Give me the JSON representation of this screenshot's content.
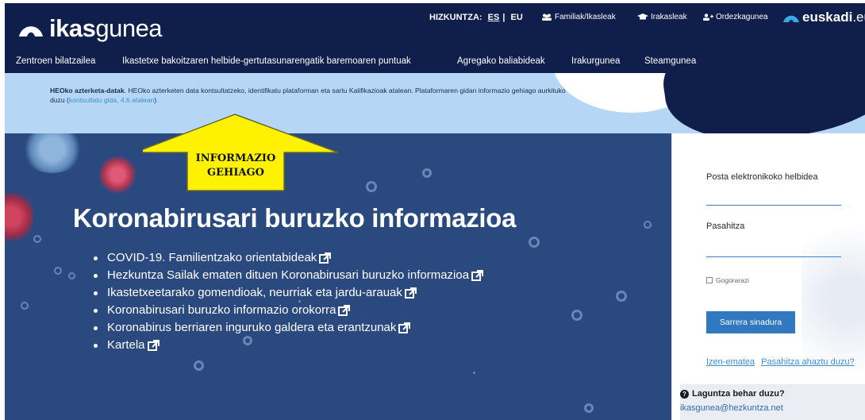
{
  "header": {
    "logo_bold": "ikas",
    "logo_light": "gunea",
    "language_label": "HIZKUNTZA:",
    "lang_es": "ES",
    "lang_sep": "|",
    "lang_eu": "EU",
    "link_families": "Familiak/Ikasleak",
    "link_teachers": "Irakasleak",
    "link_representatives": "Ordezkagunea",
    "euskadi_bold": "euskadi",
    "euskadi_light": ".eus"
  },
  "nav": {
    "items": [
      "Zentroen bilatzailea",
      "Ikastetxe bakoitzaren helbide-gertutasunarengatik baremoaren puntuak",
      "Agregako baliabideak",
      "Irakurgunea",
      "Steamgunea"
    ]
  },
  "notice": {
    "bold": "HEOko azterketa-datak",
    "text": ". HEOko azterketen data kontsultatzeko, identifikatu plataforman eta sartu Kalifikazioak atalean. Plataformaren gidan informazio gehiago aurkituko duzu (",
    "link": "kontsultatu gida, 4.6 atalean",
    "close": ")"
  },
  "annotation": {
    "line1": "INFORMAZIO",
    "line2": "GEHIAGO"
  },
  "hero": {
    "title": "Koronabirusari buruzko informazioa",
    "items": [
      "COVID-19. Familientzako orientabideak",
      "Hezkuntza Sailak ematen dituen Koronabirusari buruzko informazioa",
      "Ikastetxeetarako gomendioak, neurriak eta jardu-arauak",
      "Koronabirusari buruzko informazio orokorra",
      "Koronabirus berriaren inguruko galdera eta erantzunak",
      "Kartela"
    ]
  },
  "login": {
    "email_label": "Posta elektronikoko helbidea",
    "password_label": "Pasahitza",
    "remember_label": "Gogorarazi",
    "signin_button": "Sarrera sinadura",
    "register_link": "Izen-ematea",
    "forgot_link": "Pasahitza ahaztu duzu?",
    "help_title": "Laguntza behar duzu?",
    "help_email": "ikasgunea@hezkuntza.net"
  },
  "colors": {
    "header_bg": "#0f1e4a",
    "notice_bg": "#b5d7f5",
    "hero_bg": "#29497f",
    "annotation_yellow": "#fff200",
    "button_blue": "#3078c0"
  }
}
